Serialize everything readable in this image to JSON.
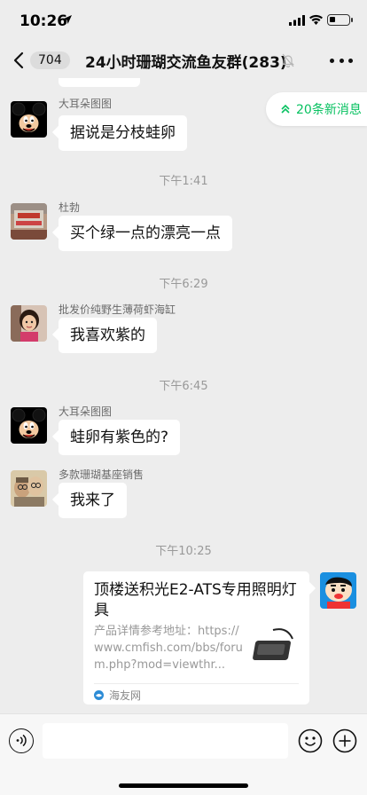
{
  "status_bar": {
    "time": "10:26",
    "battery_level": 0.3
  },
  "nav": {
    "back_count": "704",
    "title": "24小时珊瑚交流鱼友群(283)"
  },
  "new_messages": {
    "label": "20条新消息",
    "icon": "double-chevron-up-icon"
  },
  "messages": [
    {
      "sender": "大耳朵图图",
      "text": "据说是分枝蛙卵"
    },
    {
      "timestamp": "下午1:41"
    },
    {
      "sender": "杜勃",
      "text": "买个绿一点的漂亮一点"
    },
    {
      "timestamp": "下午6:29"
    },
    {
      "sender": "批发价纯野生薄荷虾海缸",
      "text": "我喜欢紫的"
    },
    {
      "timestamp": "下午6:45"
    },
    {
      "sender": "大耳朵图图",
      "text": "蛙卵有紫色的?"
    },
    {
      "sender": "多款珊瑚基座销售",
      "text": "我来了"
    },
    {
      "timestamp": "下午10:25"
    }
  ],
  "link_card": {
    "title": "顶楼送积光E2-ATS专用照明灯具",
    "description": "产品详情参考地址：https://www.cmfish.com/bbs/forum.php?mod=viewthr...",
    "source": "海友网"
  },
  "colors": {
    "accent": "#07c160",
    "background": "#ededed",
    "bubble": "#ffffff",
    "timestamp": "#999999"
  }
}
